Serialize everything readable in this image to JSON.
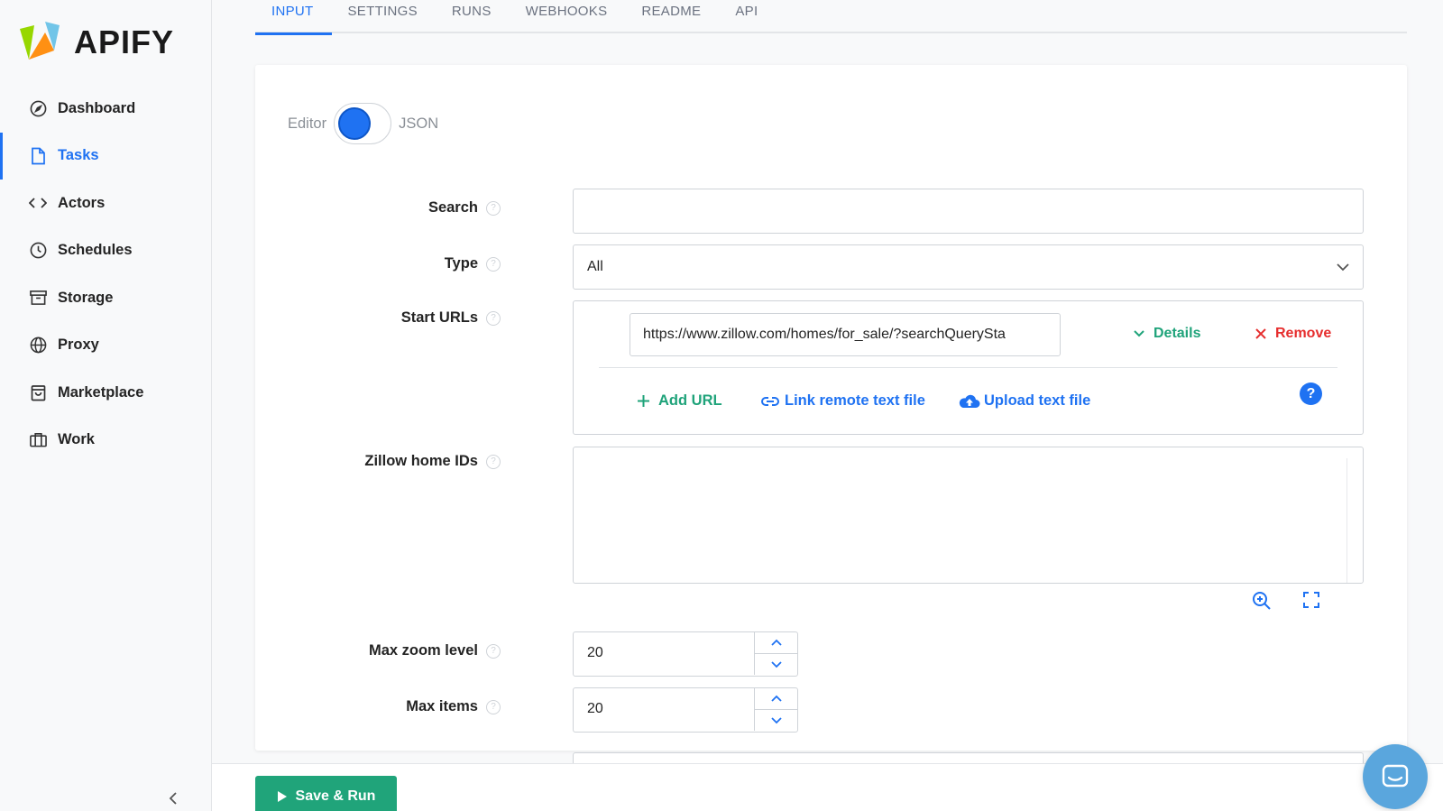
{
  "brand": {
    "name": "APIFY"
  },
  "sidebar": {
    "items": [
      {
        "label": "Dashboard",
        "icon": "compass-icon"
      },
      {
        "label": "Tasks",
        "icon": "file-icon",
        "active": true
      },
      {
        "label": "Actors",
        "icon": "code-icon"
      },
      {
        "label": "Schedules",
        "icon": "clock-icon"
      },
      {
        "label": "Storage",
        "icon": "archive-icon"
      },
      {
        "label": "Proxy",
        "icon": "globe-icon"
      },
      {
        "label": "Marketplace",
        "icon": "shopping-bag-icon"
      },
      {
        "label": "Work",
        "icon": "briefcase-icon"
      }
    ]
  },
  "tabs": [
    "INPUT",
    "SETTINGS",
    "RUNS",
    "WEBHOOKS",
    "README",
    "API"
  ],
  "active_tab": "INPUT",
  "editor_toggle": {
    "left": "Editor",
    "right": "JSON"
  },
  "form": {
    "search": {
      "label": "Search",
      "value": ""
    },
    "type": {
      "label": "Type",
      "value": "All"
    },
    "start_urls": {
      "label": "Start URLs",
      "url": "https://www.zillow.com/homes/for_sale/?searchQuerySta",
      "details": "Details",
      "remove": "Remove",
      "add_url": "Add URL",
      "link_remote": "Link remote text file",
      "upload": "Upload text file",
      "help": "?"
    },
    "zillow_ids": {
      "label": "Zillow home IDs",
      "value": ""
    },
    "max_zoom": {
      "label": "Max zoom level",
      "value": "20"
    },
    "max_items": {
      "label": "Max items",
      "value": "20"
    }
  },
  "actions": {
    "save_run": "Save & Run"
  },
  "colors": {
    "accent": "#1f72f2",
    "success": "#20a47a",
    "danger": "#e62e2e"
  }
}
